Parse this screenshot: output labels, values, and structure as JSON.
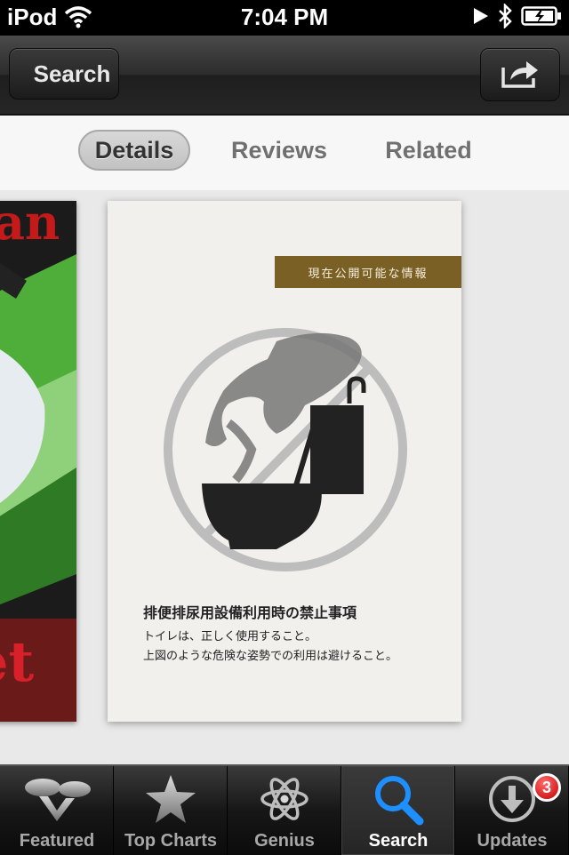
{
  "status_bar": {
    "carrier": "iPod",
    "time": "7:04 PM"
  },
  "nav_bar": {
    "back_label": "Search"
  },
  "segments": {
    "details": "Details",
    "reviews": "Reviews",
    "related": "Related"
  },
  "screenshots": {
    "left_partial_text_top": "tan",
    "left_partial_text_bottom": "et",
    "banner": "現在公開可能な情報",
    "caption_line1": "排便排尿用設備利用時の禁止事項",
    "caption_line2": "トイレは、正しく使用すること。",
    "caption_line3": "上図のような危険な姿勢での利用は避けること。"
  },
  "tab_bar": {
    "items": [
      {
        "label": "Featured",
        "icon": "featured-icon"
      },
      {
        "label": "Top Charts",
        "icon": "star-icon"
      },
      {
        "label": "Genius",
        "icon": "atom-icon"
      },
      {
        "label": "Search",
        "icon": "search-icon"
      },
      {
        "label": "Updates",
        "icon": "download-icon"
      }
    ],
    "updates_badge": "3",
    "active": "Search"
  },
  "colors": {
    "active_tab_icon": "#1e8fff",
    "badge": "#d80000",
    "banner": "#7a6025"
  }
}
